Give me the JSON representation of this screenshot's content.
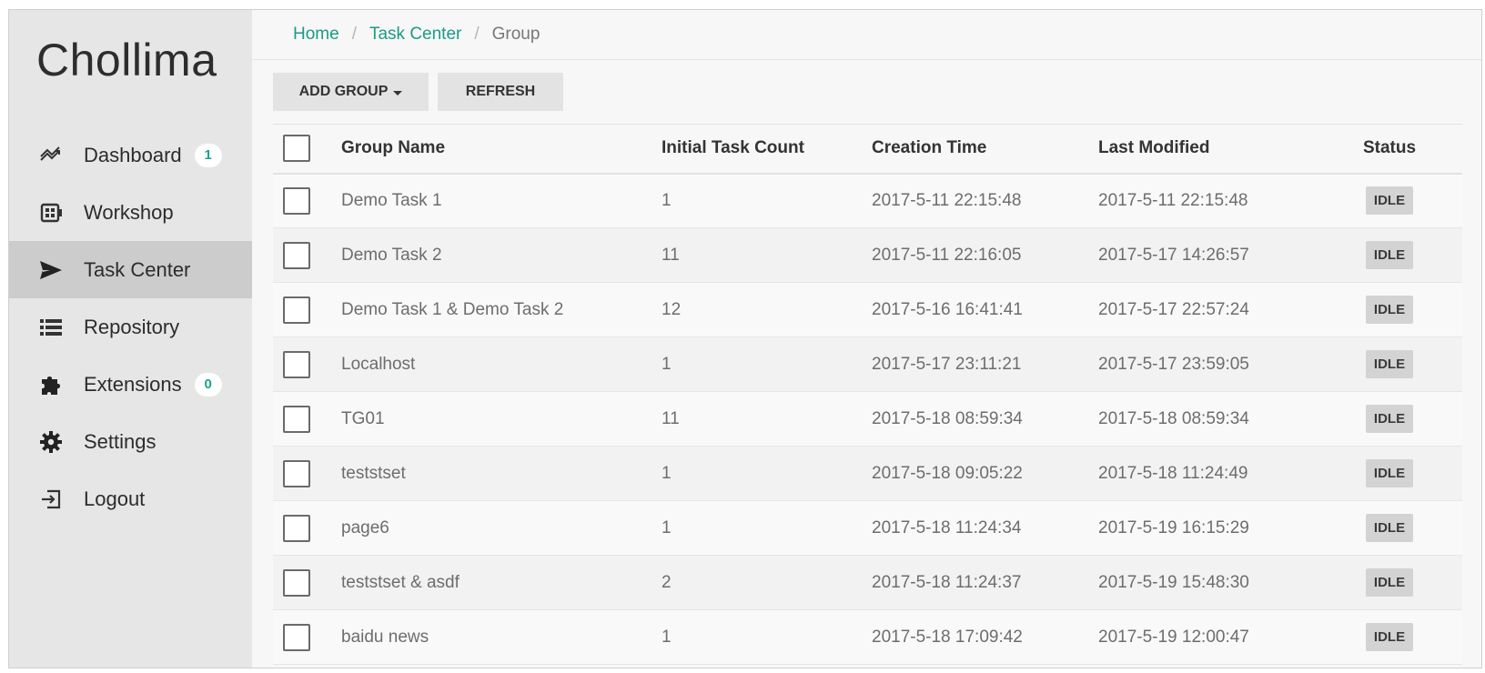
{
  "brand": {
    "name": "Chollima"
  },
  "sidebar": {
    "items": [
      {
        "label": "Dashboard",
        "icon": "trending-icon",
        "badge": "1"
      },
      {
        "label": "Workshop",
        "icon": "workshop-icon",
        "badge": null
      },
      {
        "label": "Task Center",
        "icon": "send-icon",
        "badge": null,
        "active": true
      },
      {
        "label": "Repository",
        "icon": "list-icon",
        "badge": null
      },
      {
        "label": "Extensions",
        "icon": "puzzle-icon",
        "badge": "0"
      },
      {
        "label": "Settings",
        "icon": "gear-icon",
        "badge": null
      },
      {
        "label": "Logout",
        "icon": "logout-icon",
        "badge": null
      }
    ]
  },
  "breadcrumb": {
    "home": "Home",
    "section": "Task Center",
    "current": "Group",
    "separator": "/"
  },
  "toolbar": {
    "add_group_label": "ADD GROUP",
    "refresh_label": "REFRESH"
  },
  "table": {
    "columns": [
      "Group Name",
      "Initial Task Count",
      "Creation Time",
      "Last Modified",
      "Status"
    ],
    "rows": [
      {
        "name": "Demo Task 1",
        "count": "1",
        "created": "2017-5-11 22:15:48",
        "modified": "2017-5-11 22:15:48",
        "status": "IDLE"
      },
      {
        "name": "Demo Task 2",
        "count": "11",
        "created": "2017-5-11 22:16:05",
        "modified": "2017-5-17 14:26:57",
        "status": "IDLE"
      },
      {
        "name": "Demo Task 1 & Demo Task 2",
        "count": "12",
        "created": "2017-5-16 16:41:41",
        "modified": "2017-5-17 22:57:24",
        "status": "IDLE"
      },
      {
        "name": "Localhost",
        "count": "1",
        "created": "2017-5-17 23:11:21",
        "modified": "2017-5-17 23:59:05",
        "status": "IDLE"
      },
      {
        "name": "TG01",
        "count": "11",
        "created": "2017-5-18 08:59:34",
        "modified": "2017-5-18 08:59:34",
        "status": "IDLE"
      },
      {
        "name": "teststset",
        "count": "1",
        "created": "2017-5-18 09:05:22",
        "modified": "2017-5-18 11:24:49",
        "status": "IDLE"
      },
      {
        "name": "page6",
        "count": "1",
        "created": "2017-5-18 11:24:34",
        "modified": "2017-5-19 16:15:29",
        "status": "IDLE"
      },
      {
        "name": "teststset & asdf",
        "count": "2",
        "created": "2017-5-18 11:24:37",
        "modified": "2017-5-19 15:48:30",
        "status": "IDLE"
      },
      {
        "name": "baidu news",
        "count": "1",
        "created": "2017-5-18 17:09:42",
        "modified": "2017-5-19 12:00:47",
        "status": "IDLE"
      }
    ]
  },
  "colors": {
    "accent": "#1d9a87",
    "sidebar_bg": "#e6e6e6",
    "sidebar_active": "#cccccc",
    "status_badge_bg": "#d3d3d3"
  }
}
